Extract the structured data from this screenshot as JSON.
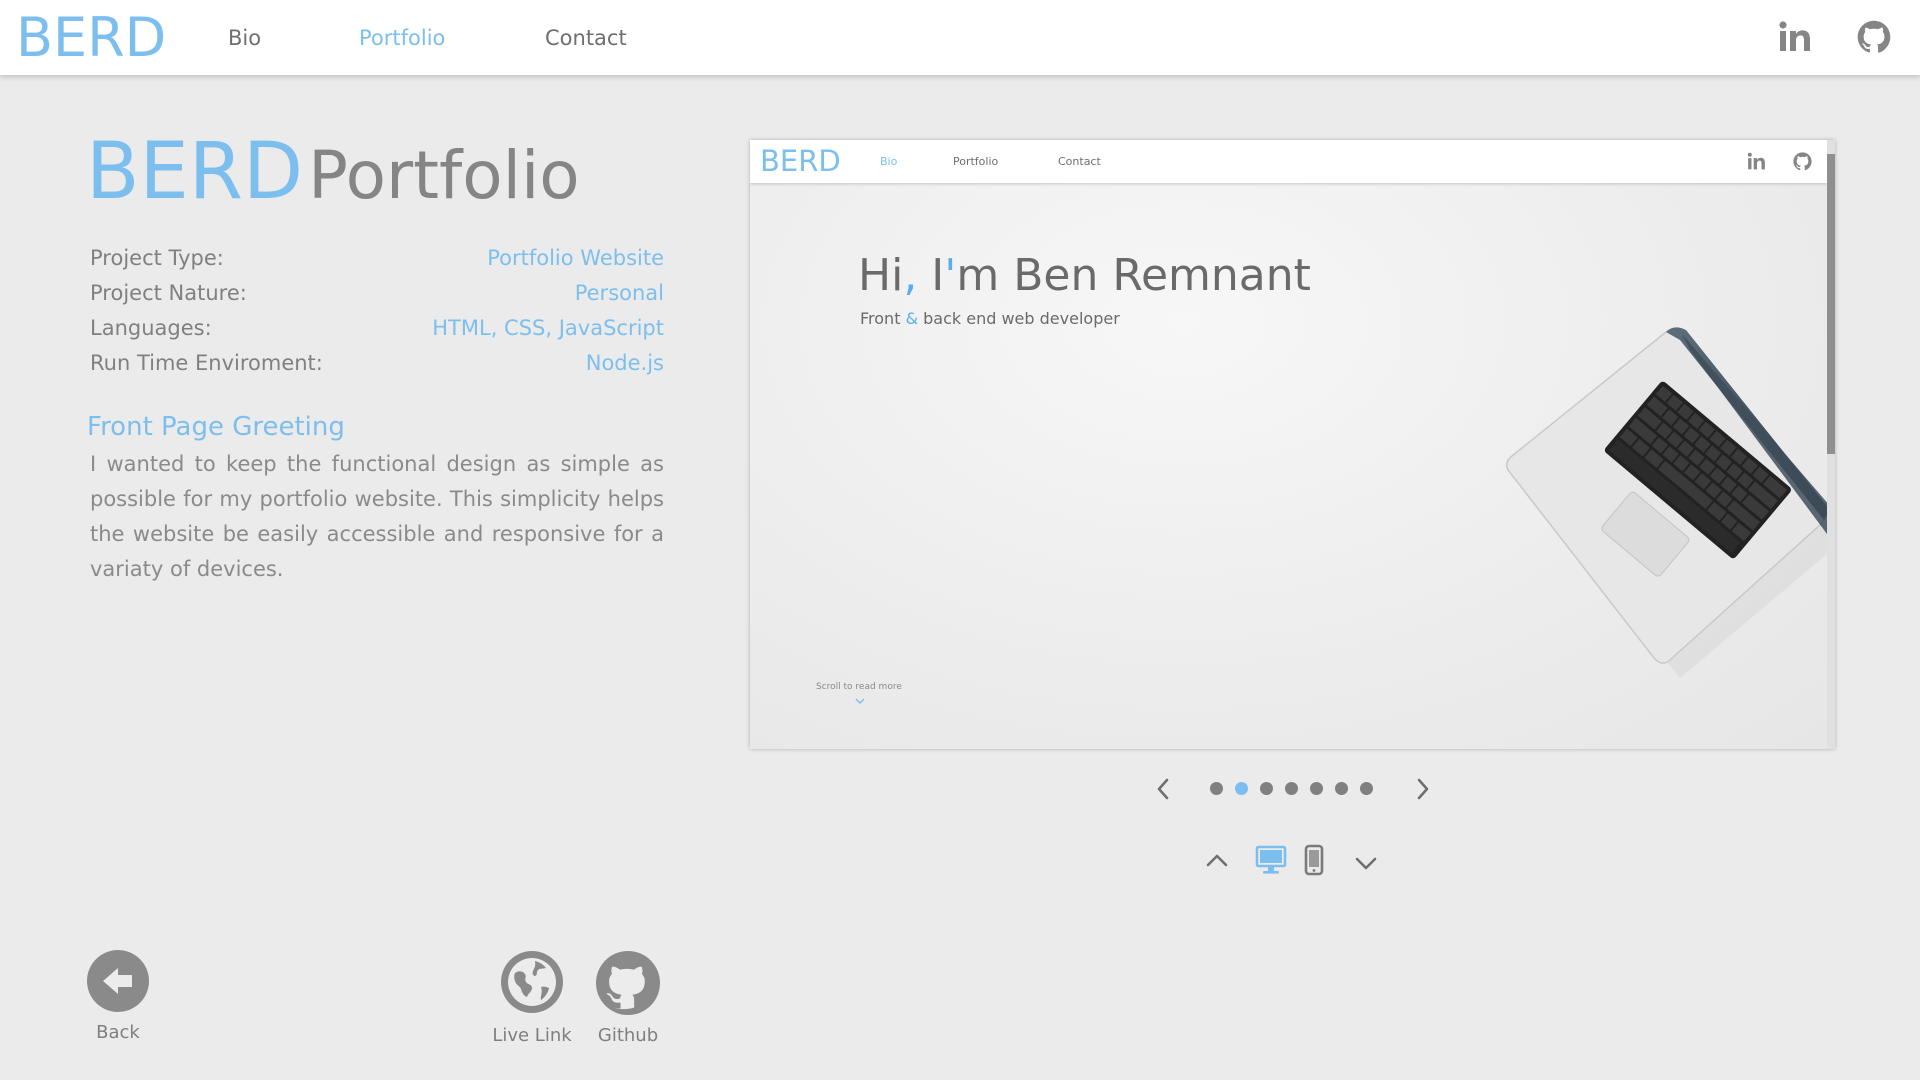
{
  "nav": {
    "logo": "BERD",
    "links": [
      "Bio",
      "Portfolio",
      "Contact"
    ],
    "active_link": "Portfolio",
    "icons": [
      "linkedin-icon",
      "github-icon"
    ],
    "accent_color": "#7cbfee"
  },
  "project": {
    "title_brand": "BERD",
    "title_rest": "Portfolio",
    "details": [
      {
        "label": "Project Type:",
        "value": "Portfolio Website"
      },
      {
        "label": "Project Nature:",
        "value": "Personal"
      },
      {
        "label": "Languages:",
        "value": "HTML, CSS, JavaScript"
      },
      {
        "label": "Run Time Enviroment:",
        "value": "Node.js"
      }
    ],
    "section_title": "Front Page Greeting",
    "description": "I wanted to keep the functional design as simple as possible for my portfolio website. This simplicity helps the website be easily accessible and responsive for a variaty of devices."
  },
  "actions": {
    "back": "Back",
    "live_link": "Live Link",
    "github": "Github"
  },
  "preview": {
    "logo": "BERD",
    "links": [
      "Bio",
      "Portfolio",
      "Contact"
    ],
    "active_link": "Bio",
    "greeting_1": "Hi",
    "greeting_comma": ",",
    "greeting_2": " I",
    "greeting_apos": "'",
    "greeting_3": "m Ben Remnant",
    "sub_1": "Front ",
    "sub_amp": "&",
    "sub_2": " back end web developer",
    "scroll_hint": "Scroll to read more"
  },
  "carousel": {
    "dot_count": 7,
    "active_dot": 2
  },
  "device_selector": {
    "options": [
      "desktop-icon",
      "mobile-icon"
    ],
    "active": "desktop-icon"
  }
}
